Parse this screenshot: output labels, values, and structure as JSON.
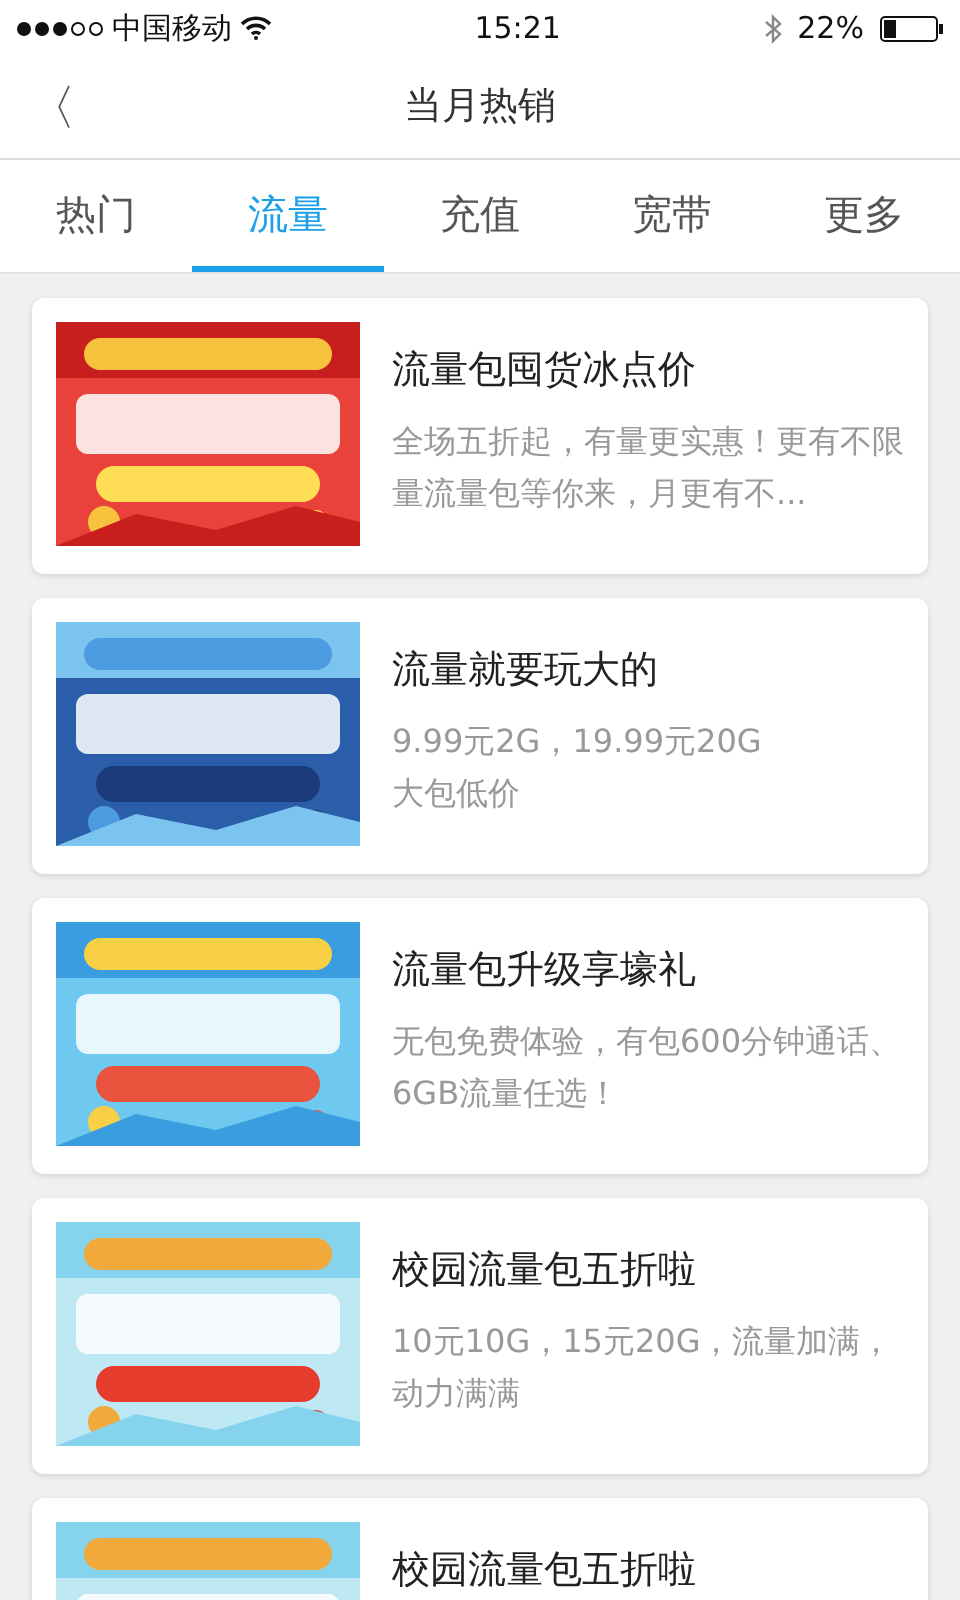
{
  "status_bar": {
    "carrier": "中国移动",
    "time": "15:21",
    "battery": "22%"
  },
  "nav": {
    "back": "〈",
    "title": "当月热销"
  },
  "tabs": [
    {
      "label": "热门",
      "selected": false
    },
    {
      "label": "流量",
      "selected": true
    },
    {
      "label": "充值",
      "selected": false
    },
    {
      "label": "宽带",
      "selected": false
    },
    {
      "label": "更多",
      "selected": false
    }
  ],
  "items": [
    {
      "title": "流量包囤货冰点价",
      "description": "全场五折起，有量更实惠！更有不限量流量包等你来，月更有不..."
    },
    {
      "title": "流量就要玩大的",
      "description": "9.99元2G，19.99元20G\n大包低价"
    },
    {
      "title": "流量包升级享壕礼",
      "description": "无包免费体验，有包600分钟通话、6GB流量任选！"
    },
    {
      "title": "校园流量包五折啦",
      "description": "10元10G，15元20G，流量加满，动力满满"
    },
    {
      "title": "校园流量包五折啦"
    }
  ]
}
